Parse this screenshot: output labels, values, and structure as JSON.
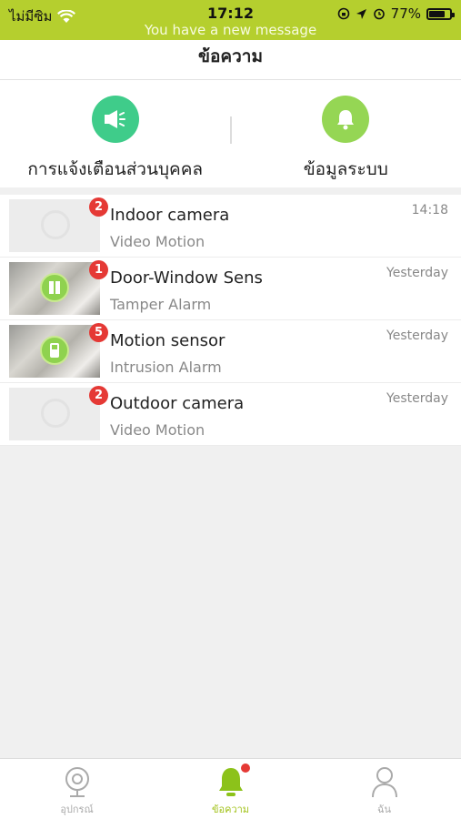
{
  "status_bar": {
    "carrier": "ไม่มีซิม",
    "time": "17:12",
    "banner": "You have a new message",
    "battery": "77%",
    "battery_level": 0.77
  },
  "header": {
    "title": "ข้อความ"
  },
  "categories": [
    {
      "label": "การแจ้งเตือนส่วนบุคคล",
      "icon": "megaphone-icon",
      "color": "#3fcc8a"
    },
    {
      "label": "ข้อมูลระบบ",
      "icon": "bell-icon",
      "color": "#95d654"
    }
  ],
  "messages": [
    {
      "device": "Indoor camera",
      "event": "Video Motion",
      "time": "14:18",
      "count": "2",
      "icon": "camera-icon"
    },
    {
      "device": "Door-Window Sens",
      "event": "Tamper Alarm",
      "time": "Yesterday",
      "count": "1",
      "icon": "door-sensor-icon"
    },
    {
      "device": "Motion sensor",
      "event": "Intrusion Alarm",
      "time": "Yesterday",
      "count": "5",
      "icon": "motion-sensor-icon"
    },
    {
      "device": "Outdoor camera",
      "event": "Video Motion",
      "time": "Yesterday",
      "count": "2",
      "icon": "camera-icon"
    }
  ],
  "tabs": [
    {
      "label": "อุปกรณ์",
      "icon": "camera-icon",
      "active": false
    },
    {
      "label": "ข้อความ",
      "icon": "bell-icon",
      "active": true
    },
    {
      "label": "ฉัน",
      "icon": "person-icon",
      "active": false
    }
  ],
  "colors": {
    "accent": "#b5cf2e",
    "badge": "#e53935"
  }
}
